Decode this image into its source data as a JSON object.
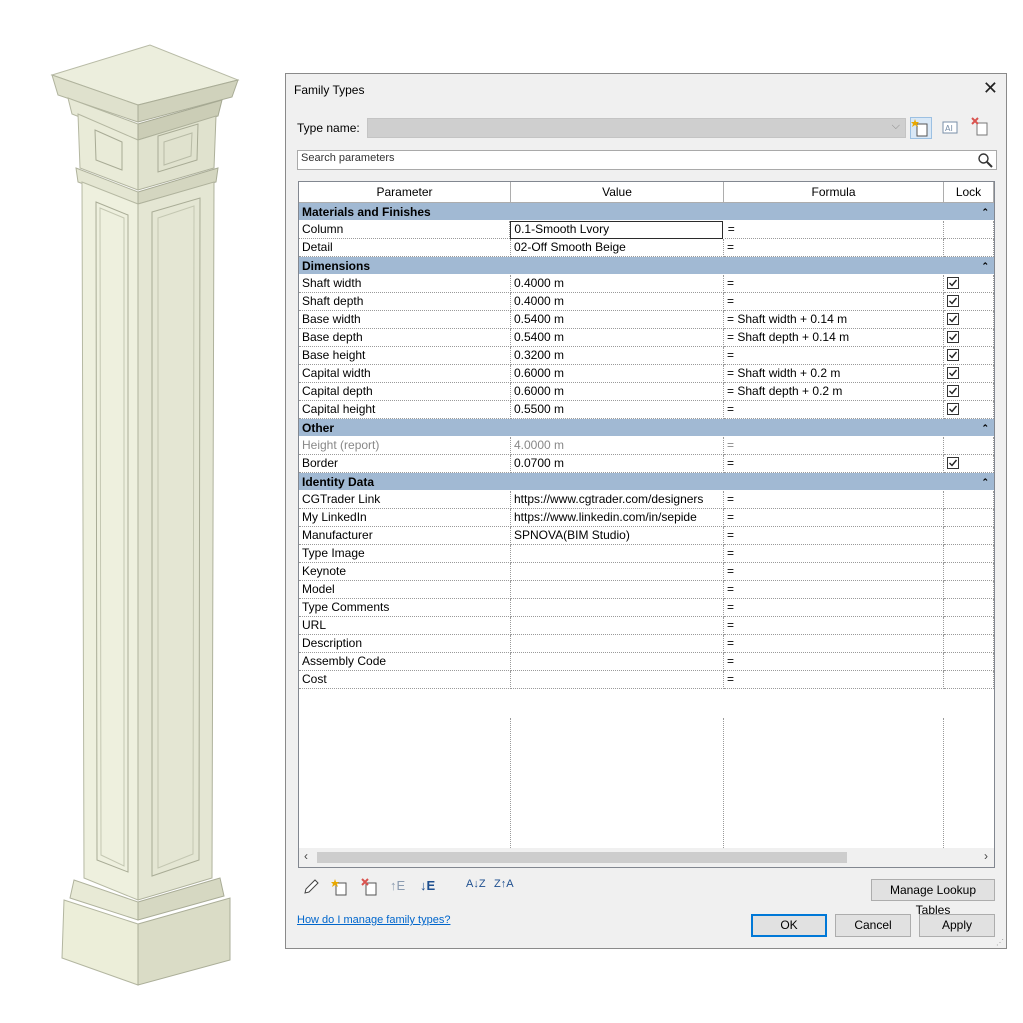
{
  "dialog": {
    "title": "Family Types",
    "type_name_label": "Type name:",
    "type_name_value": "",
    "search_placeholder": "Search parameters",
    "columns": [
      "Parameter",
      "Value",
      "Formula",
      "Lock"
    ],
    "groups": [
      {
        "name": "Materials and Finishes",
        "rows": [
          {
            "param": "Column",
            "value": "0.1-Smooth Lvory",
            "formula": "=",
            "lock": null,
            "editing": true
          },
          {
            "param": "Detail",
            "value": "02-Off Smooth Beige",
            "formula": "=",
            "lock": null
          }
        ]
      },
      {
        "name": "Dimensions",
        "rows": [
          {
            "param": "Shaft width",
            "value": "0.4000 m",
            "formula": "=",
            "lock": true
          },
          {
            "param": "Shaft depth",
            "value": "0.4000 m",
            "formula": "=",
            "lock": true
          },
          {
            "param": "Base width",
            "value": "0.5400 m",
            "formula": "= Shaft width + 0.14 m",
            "lock": true
          },
          {
            "param": "Base depth",
            "value": "0.5400 m",
            "formula": "= Shaft depth + 0.14 m",
            "lock": true
          },
          {
            "param": "Base height",
            "value": "0.3200 m",
            "formula": "=",
            "lock": true
          },
          {
            "param": "Capital width",
            "value": "0.6000 m",
            "formula": "= Shaft width + 0.2 m",
            "lock": true
          },
          {
            "param": "Capital depth",
            "value": "0.6000 m",
            "formula": "= Shaft depth + 0.2 m",
            "lock": true
          },
          {
            "param": "Capital height",
            "value": "0.5500 m",
            "formula": "=",
            "lock": true
          }
        ]
      },
      {
        "name": "Other",
        "rows": [
          {
            "param": "Height (report)",
            "value": "4.0000 m",
            "formula": "=",
            "lock": null,
            "dim": true
          },
          {
            "param": "Border",
            "value": "0.0700 m",
            "formula": "=",
            "lock": true
          }
        ]
      },
      {
        "name": "Identity Data",
        "rows": [
          {
            "param": "CGTrader Link",
            "value": "https://www.cgtrader.com/designers",
            "formula": "=",
            "lock": null
          },
          {
            "param": "My LinkedIn",
            "value": "https://www.linkedin.com/in/sepide",
            "formula": "=",
            "lock": null
          },
          {
            "param": "Manufacturer",
            "value": "SPNOVA(BIM Studio)",
            "formula": "=",
            "lock": null
          },
          {
            "param": "Type Image",
            "value": "",
            "formula": "=",
            "lock": null
          },
          {
            "param": "Keynote",
            "value": "",
            "formula": "=",
            "lock": null
          },
          {
            "param": "Model",
            "value": "",
            "formula": "=",
            "lock": null
          },
          {
            "param": "Type Comments",
            "value": "",
            "formula": "=",
            "lock": null
          },
          {
            "param": "URL",
            "value": "",
            "formula": "=",
            "lock": null
          },
          {
            "param": "Description",
            "value": "",
            "formula": "=",
            "lock": null
          },
          {
            "param": "Assembly Code",
            "value": "",
            "formula": "=",
            "lock": null
          },
          {
            "param": "Cost",
            "value": "",
            "formula": "=",
            "lock": null
          }
        ]
      }
    ],
    "manage_lookup_label": "Manage Lookup Tables",
    "help_link": "How do I manage family types?",
    "ok_label": "OK",
    "cancel_label": "Cancel",
    "apply_label": "Apply"
  },
  "colors": {
    "group_header": "#a1b9d3",
    "link": "#0066cc",
    "accent": "#0078d7"
  },
  "icons": [
    "close-icon",
    "new-type-icon",
    "rename-type-icon",
    "delete-type-icon",
    "search-icon",
    "edit-parameter-icon",
    "new-parameter-icon",
    "delete-parameter-icon",
    "move-up-icon",
    "move-down-icon",
    "sort-ascending-icon",
    "sort-descending-icon",
    "collapse-icon"
  ]
}
